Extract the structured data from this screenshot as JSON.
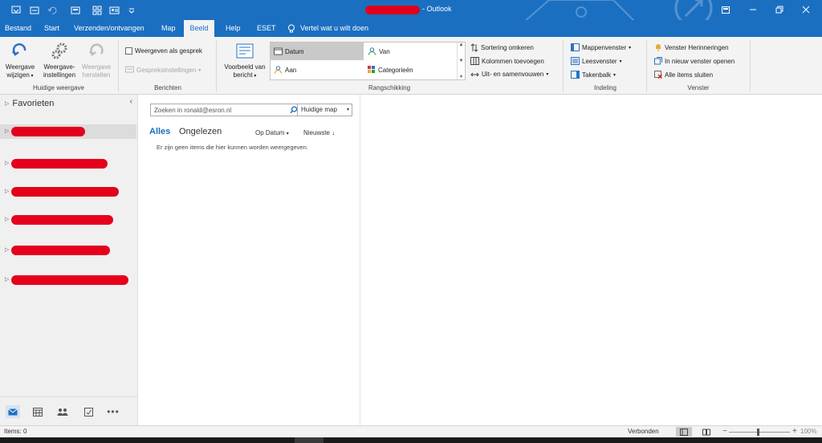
{
  "app": {
    "title": "- Outlook"
  },
  "tabs": [
    {
      "label": "Bestand"
    },
    {
      "label": "Start"
    },
    {
      "label": "Verzenden/ontvangen"
    },
    {
      "label": "Map"
    },
    {
      "label": "Beeld",
      "active": true
    },
    {
      "label": "Help"
    },
    {
      "label": "ESET"
    }
  ],
  "tell_me": "Vertel wat u wilt doen",
  "ribbon": {
    "current_view": {
      "change_view": "Weergave wijzigen",
      "view_settings": "Weergave-instellingen",
      "reset_view": "Weergave herstellen",
      "group_label": "Huidige weergave"
    },
    "messages": {
      "show_as_conversations": "Weergeven als gesprek",
      "conversation_settings": "Gespreksinstellingen",
      "group_label": "Berichten"
    },
    "arrangement": {
      "message_preview": "Voorbeeld van bericht",
      "gallery": [
        "Datum",
        "Van",
        "Aan",
        "Categorieën"
      ],
      "selected": "Datum",
      "reverse_sort": "Sortering omkeren",
      "add_columns": "Kolommen toevoegen",
      "expand_collapse": "Uit- en samenvouwen",
      "group_label": "Rangschikking"
    },
    "layout": {
      "folder_pane": "Mappenvenster",
      "reading_pane": "Leesvenster",
      "todo_bar": "Takenbalk",
      "group_label": "Indeling"
    },
    "window": {
      "reminders": "Venster Herinneringen",
      "open_new_window": "In nieuw venster openen",
      "close_all": "Alle items sluiten",
      "group_label": "Venster"
    }
  },
  "nav": {
    "favorites": "Favorieten"
  },
  "message_list": {
    "search_placeholder": "Zoeken in ronald@esron.nl",
    "search_scope": "Huidige map",
    "filter_all": "Alles",
    "filter_unread": "Ongelezen",
    "sort_by": "Op Datum",
    "sort_order": "Nieuwste",
    "empty_text": "Er zijn geen items die hier kunnen worden weergegeven."
  },
  "status": {
    "items": "Items: 0",
    "connection": "Verbonden",
    "zoom": "100%"
  },
  "colors": {
    "accent": "#1b6fc1",
    "redaction": "#e5001c"
  }
}
